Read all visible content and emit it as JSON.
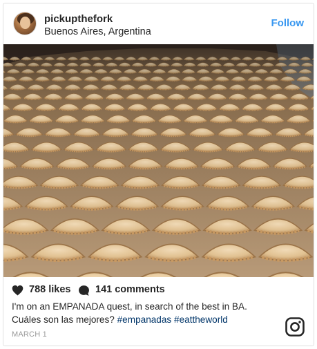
{
  "post": {
    "username": "pickupthefork",
    "location": "Buenos Aires, Argentina",
    "follow_label": "Follow",
    "likes": "788 likes",
    "comments": "141 comments",
    "caption_line1": "I'm on an EMPANADA quest, in search of the best in BA.",
    "caption_line2_text": "Cuáles son las mejores? ",
    "hashtags": [
      "#empanadas",
      "#eattheworld"
    ],
    "date": "MARCH 1"
  },
  "icons": {
    "avatar": "profile-photo",
    "like": "heart-icon",
    "comment": "comment-bubble-icon",
    "brand": "instagram-logo-icon"
  },
  "colors": {
    "accent": "#3897f0",
    "hashtag": "#003569",
    "text": "#262626",
    "muted": "#999999"
  }
}
